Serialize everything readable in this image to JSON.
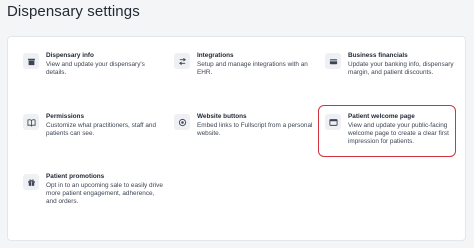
{
  "page": {
    "title": "Dispensary settings"
  },
  "cards": [
    {
      "key": "dispensary-info",
      "icon": "storefront-icon",
      "title": "Dispensary info",
      "desc": "View and update your dispensary's details."
    },
    {
      "key": "integrations",
      "icon": "swap-arrows-icon",
      "title": "Integrations",
      "desc": "Setup and manage integrations with an EHR."
    },
    {
      "key": "business-financials",
      "icon": "credit-card-icon",
      "title": "Business financials",
      "desc": "Update your banking info, dispensary margin, and patient discounts."
    },
    {
      "key": "permissions",
      "icon": "book-icon",
      "title": "Permissions",
      "desc": "Customize what practitioners, staff and patients can see."
    },
    {
      "key": "website-buttons",
      "icon": "target-icon",
      "title": "Website buttons",
      "desc": "Embed links to Fullscript from a personal website."
    },
    {
      "key": "patient-welcome-page",
      "icon": "browser-window-icon",
      "title": "Patient welcome page",
      "desc": "View and update your public-facing welcome page to create a clear first impression for patients."
    },
    {
      "key": "patient-promotions",
      "icon": "gift-icon",
      "title": "Patient promotions",
      "desc": "Opt in to an upcoming sale to easily drive more patient engagement, adherence, and orders."
    }
  ],
  "colors": {
    "highlight": "#d0343e",
    "icon_bg": "#eef0f3",
    "icon_fg": "#3a4452"
  }
}
